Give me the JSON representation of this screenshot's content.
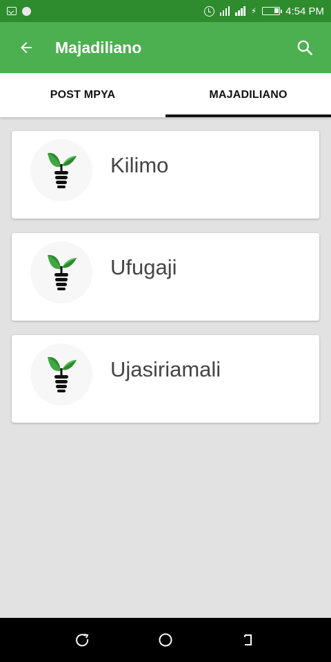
{
  "status_bar": {
    "time": "4:54 PM",
    "icons": [
      "notification-icon",
      "dot-icon",
      "alarm-icon",
      "signal-icon",
      "signal-icon",
      "charging-icon",
      "battery-icon"
    ]
  },
  "app_bar": {
    "title": "Majadiliano",
    "back_icon": "arrow-left-icon",
    "search_icon": "search-icon",
    "color": "#4caf50"
  },
  "tabs": [
    {
      "label": "POST MPYA",
      "active": false
    },
    {
      "label": "MAJADILIANO",
      "active": true
    }
  ],
  "categories": [
    {
      "label": "Kilimo",
      "icon": "plant-bulb-icon"
    },
    {
      "label": "Ufugaji",
      "icon": "plant-bulb-icon"
    },
    {
      "label": "Ujasiriamali",
      "icon": "plant-bulb-icon"
    }
  ],
  "nav_bar": {
    "icons": [
      "recent-apps-icon",
      "home-icon",
      "back-icon"
    ]
  }
}
